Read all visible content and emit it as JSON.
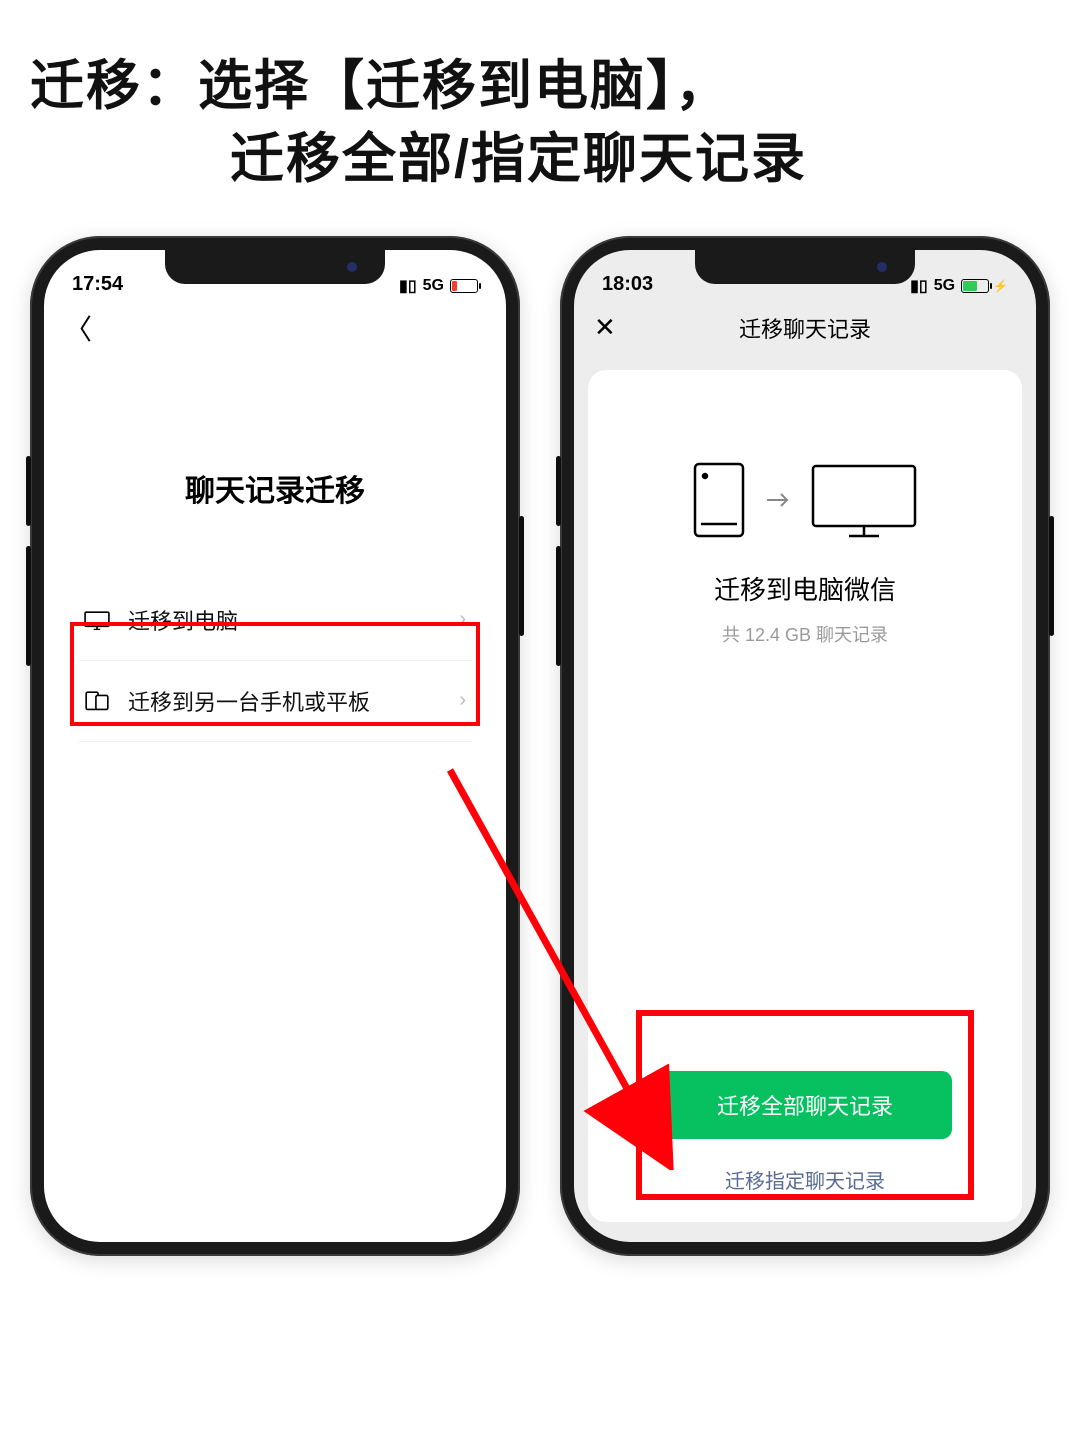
{
  "headline": {
    "line1": "迁移：选择【迁移到电脑】，",
    "line2": "迁移全部/指定聊天记录"
  },
  "phone1": {
    "status": {
      "time": "17:54",
      "network": "5G",
      "battery_state": "low"
    },
    "page_title": "聊天记录迁移",
    "options": [
      {
        "icon": "desktop",
        "label": "迁移到电脑",
        "highlighted": true
      },
      {
        "icon": "devices",
        "label": "迁移到另一台手机或平板",
        "highlighted": false
      }
    ]
  },
  "phone2": {
    "status": {
      "time": "18:03",
      "network": "5G",
      "battery_state": "charging"
    },
    "nav_title": "迁移聊天记录",
    "title": "迁移到电脑微信",
    "subtitle": "共 12.4 GB 聊天记录",
    "primary_button": "迁移全部聊天记录",
    "secondary_link": "迁移指定聊天记录"
  }
}
